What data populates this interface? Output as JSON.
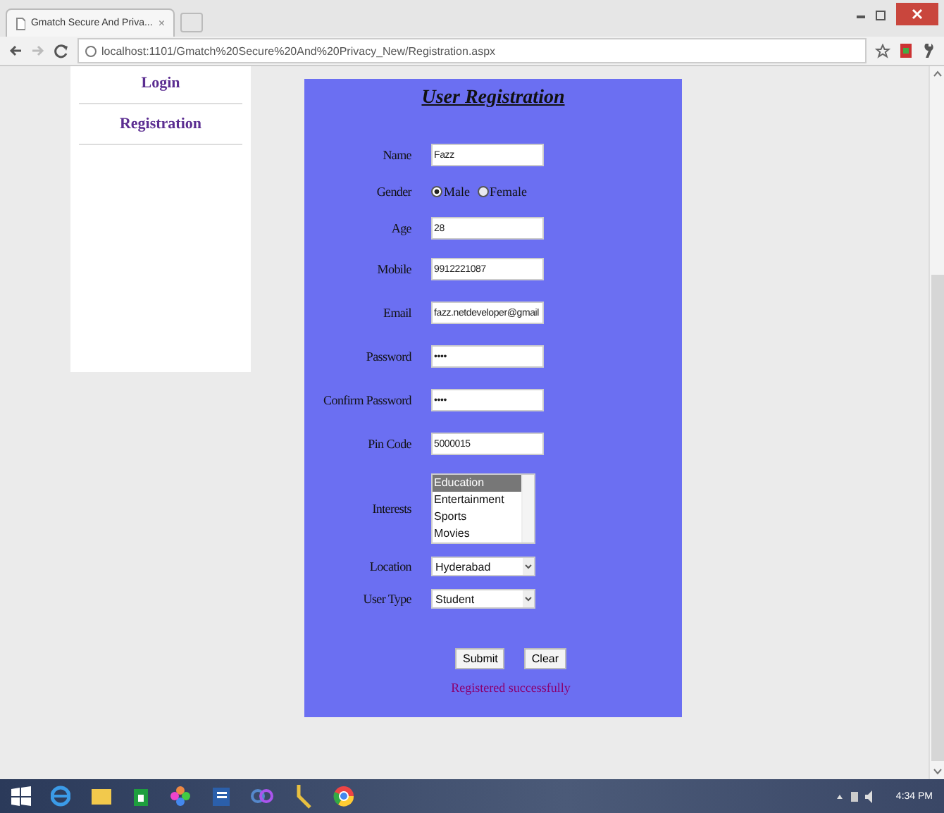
{
  "browser": {
    "tab_title": "Gmatch Secure And Priva...",
    "tab_close": "×",
    "url": "localhost:1101/Gmatch%20Secure%20And%20Privacy_New/Registration.aspx"
  },
  "sidebar": {
    "items": [
      {
        "label": "Login"
      },
      {
        "label": "Registration"
      }
    ]
  },
  "form": {
    "title": "User Registration",
    "fields": [
      {
        "kind": "text",
        "label": "Name",
        "value": "Fazz"
      },
      {
        "kind": "radio",
        "label": "Gender",
        "options": [
          {
            "label": "Male",
            "selected": true
          },
          {
            "label": "Female",
            "selected": false
          }
        ]
      },
      {
        "kind": "text",
        "label": "Age",
        "value": "28"
      },
      {
        "kind": "text",
        "label": "Mobile",
        "value": "9912221087"
      },
      {
        "kind": "text",
        "label": "Email",
        "value": "fazz.netdeveloper@gmail"
      },
      {
        "kind": "text",
        "label": "Password",
        "value": "••••"
      },
      {
        "kind": "text",
        "label": "Confirm Password",
        "value": "••••"
      },
      {
        "kind": "text",
        "label": "Pin Code",
        "value": "5000015"
      },
      {
        "kind": "listbox",
        "label": "Interests",
        "options": [
          {
            "label": "Education",
            "selected": true
          },
          {
            "label": "Entertainment",
            "selected": false
          },
          {
            "label": "Sports",
            "selected": false
          },
          {
            "label": "Movies",
            "selected": false
          }
        ]
      },
      {
        "kind": "select",
        "label": "Location",
        "value": "Hyderabad"
      },
      {
        "kind": "select",
        "label": "User Type",
        "value": "Student"
      }
    ],
    "buttons": [
      "Submit",
      "Clear"
    ],
    "message": "Registered successfully"
  },
  "taskbar": {
    "clock": "4:34 PM"
  }
}
